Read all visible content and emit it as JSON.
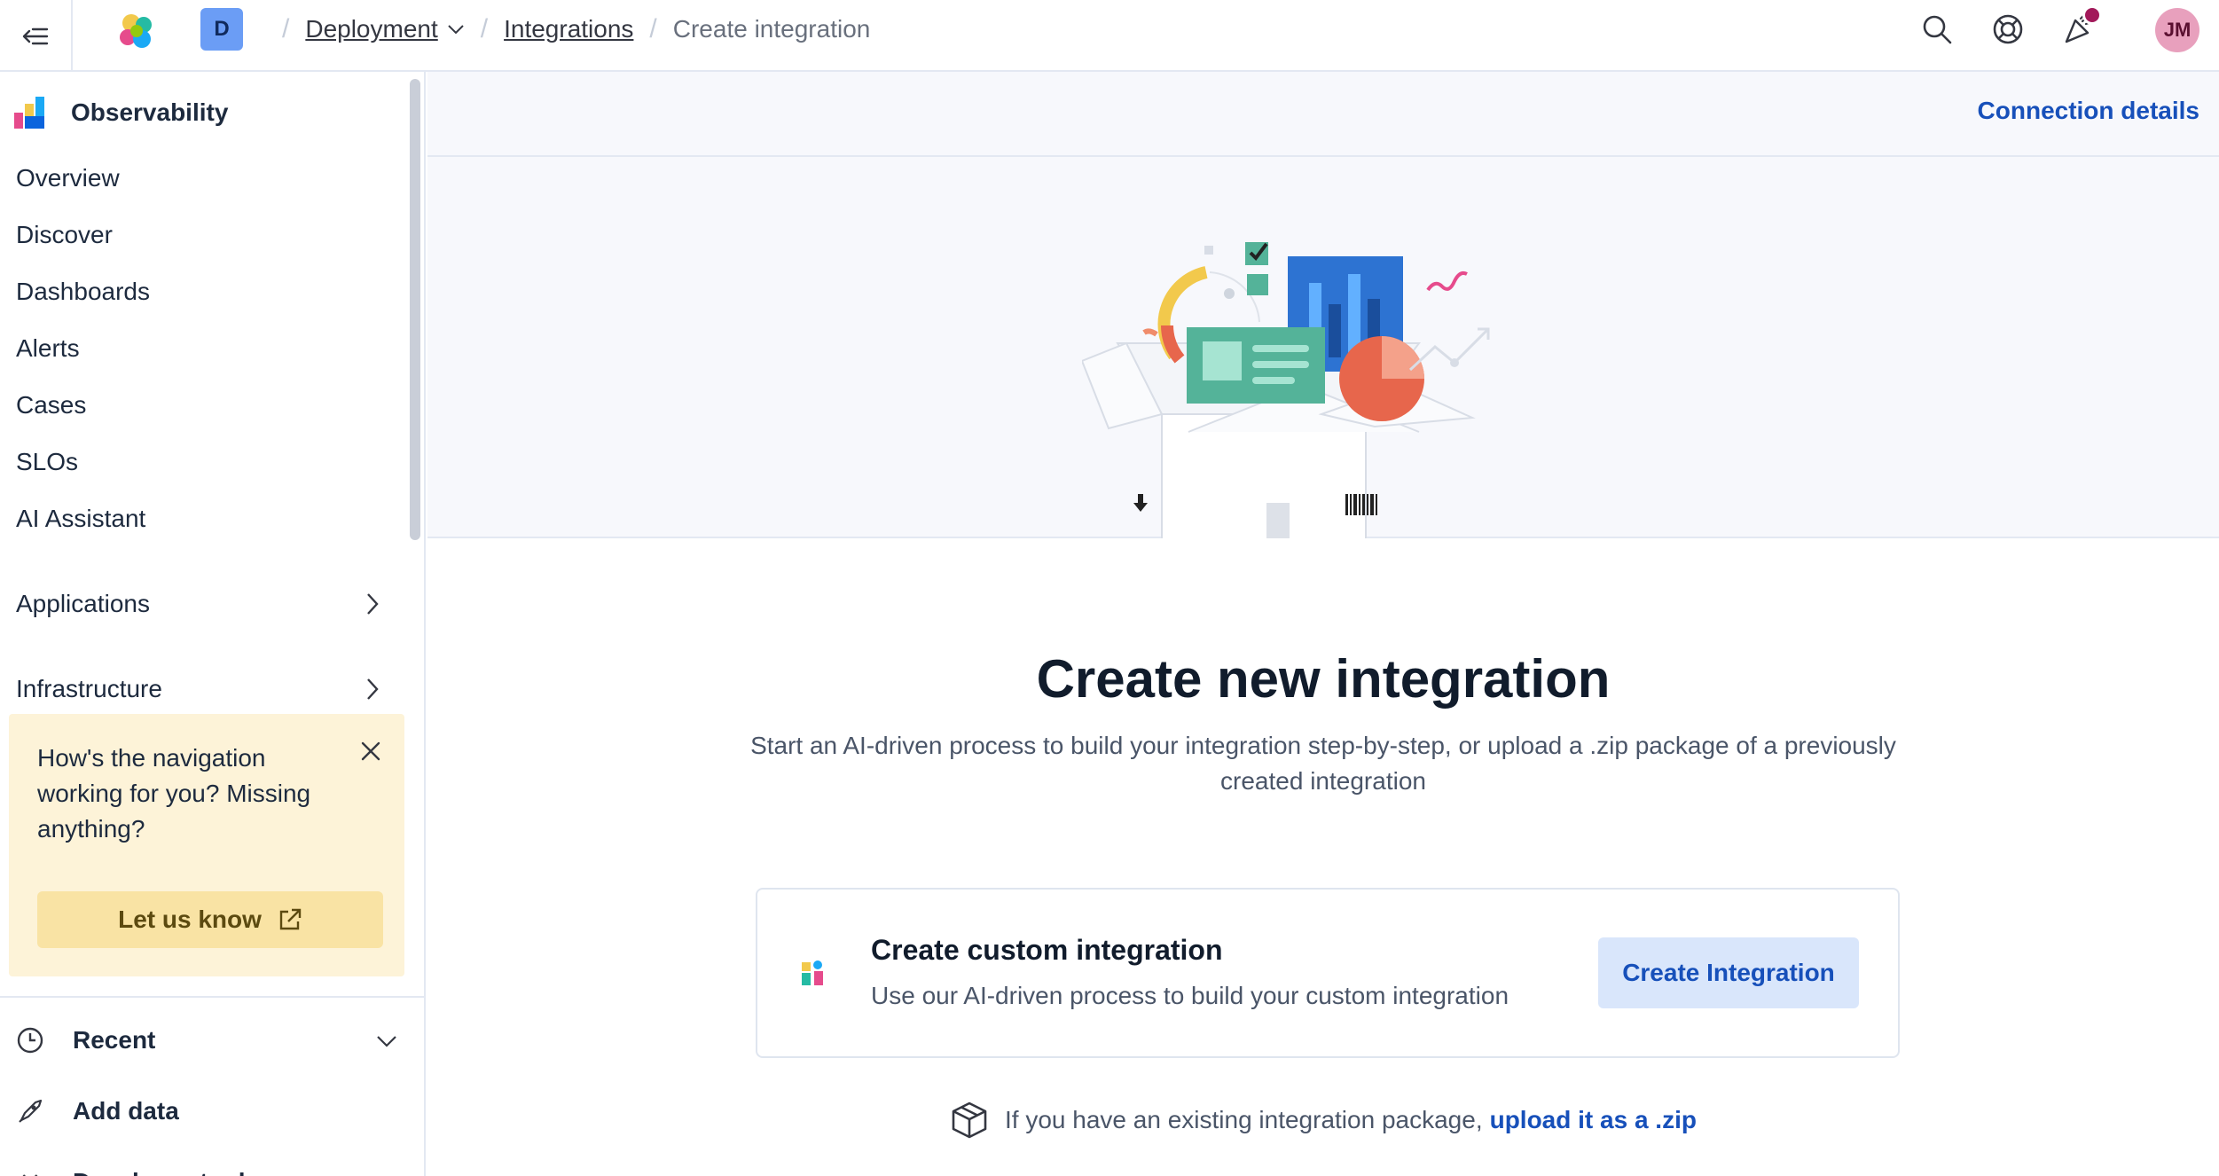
{
  "header": {
    "menu_icon": "collapse-menu-icon",
    "logo_icon": "elastic-logo-icon",
    "space_initial": "D",
    "breadcrumbs": [
      {
        "label": "Deployment"
      },
      {
        "label": "Integrations"
      },
      {
        "label": "Create integration"
      }
    ],
    "icons": [
      "search-icon",
      "help-icon",
      "news-feed-icon"
    ],
    "avatar_initials": "JM"
  },
  "sidebar": {
    "section_title": "Observability",
    "items": [
      {
        "label": "Overview"
      },
      {
        "label": "Discover"
      },
      {
        "label": "Dashboards"
      },
      {
        "label": "Alerts"
      },
      {
        "label": "Cases"
      },
      {
        "label": "SLOs"
      },
      {
        "label": "AI Assistant"
      }
    ],
    "groups": [
      {
        "label": "Applications"
      },
      {
        "label": "Infrastructure"
      }
    ],
    "feedback": {
      "text": "How's the navigation working for you? Missing anything?",
      "button": "Let us know"
    },
    "bottom": [
      {
        "label": "Recent",
        "icon": "clock-icon"
      },
      {
        "label": "Add data",
        "icon": "rocket-icon"
      },
      {
        "label": "Developer tools",
        "icon": "code-icon"
      }
    ]
  },
  "main": {
    "connection_details": "Connection details",
    "title": "Create new integration",
    "subtitle": "Start an AI-driven process to build your integration step-by-step, or upload a .zip package of a previously created integration",
    "card": {
      "title": "Create custom integration",
      "description": "Use our AI-driven process to build your custom integration",
      "button": "Create Integration"
    },
    "upload": {
      "text": "If you have an existing integration package,",
      "link": "upload it as a .zip"
    }
  },
  "colors": {
    "accent": "#1750ba",
    "button_bg": "#d9e6fb",
    "feedback_bg": "#fdf3d8",
    "avatar_bg": "#e8a0bd",
    "space_bg": "#6b9df5"
  }
}
